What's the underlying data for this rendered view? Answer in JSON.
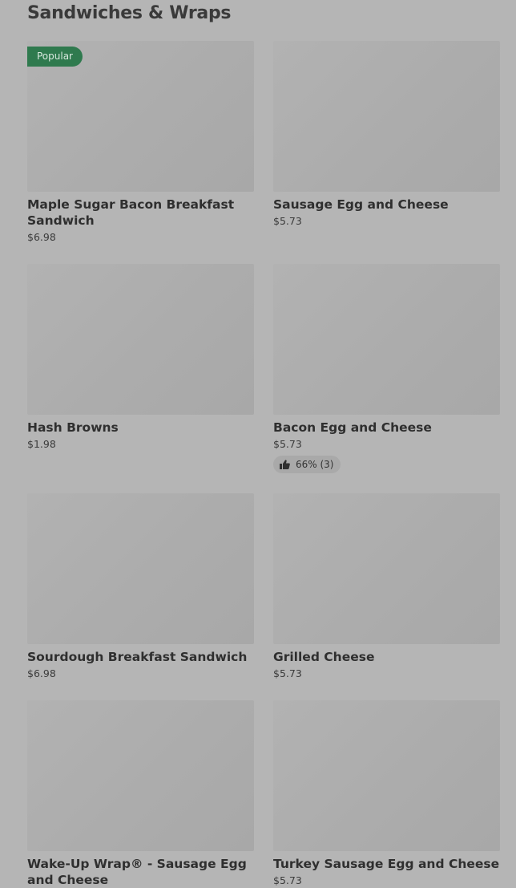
{
  "section": {
    "title": "Sandwiches & Wraps"
  },
  "items": [
    {
      "name": "Maple Sugar Bacon Breakfast Sandwich",
      "price": "$6.98",
      "badge": "Popular"
    },
    {
      "name": "Sausage Egg and Cheese",
      "price": "$5.73"
    },
    {
      "name": "Hash Browns",
      "price": "$1.98"
    },
    {
      "name": "Bacon Egg and Cheese",
      "price": "$5.73",
      "rating": "66% (3)",
      "rating_icon": "thumbs-up-icon"
    },
    {
      "name": "Sourdough Breakfast Sandwich",
      "price": "$6.98"
    },
    {
      "name": "Grilled Cheese",
      "price": "$5.73"
    },
    {
      "name": "Wake-Up Wrap® - Sausage Egg and Cheese",
      "price": ""
    },
    {
      "name": "Turkey Sausage Egg and Cheese",
      "price": "$5.73"
    }
  ],
  "colors": {
    "background": "#b5b5b5",
    "badge": "#2f7a4e"
  }
}
